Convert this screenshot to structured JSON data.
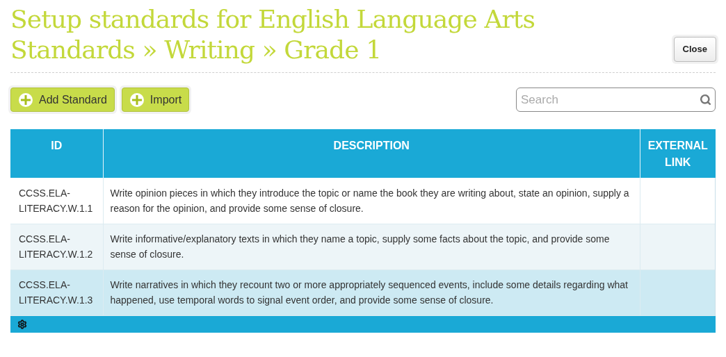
{
  "title_lines": [
    "Setup standards for English Language Arts",
    "Standards » Writing » Grade 1"
  ],
  "close_button": "Close",
  "toolbar_buttons": [
    "Add Standard",
    "Import"
  ],
  "search": {
    "placeholder": "Search"
  },
  "table": {
    "columns": [
      "ID",
      "DESCRIPTION",
      "EXTERNAL LINK"
    ],
    "rows": [
      {
        "id": "CCSS.ELA-LITERACY.W.1.1",
        "description": "Write opinion pieces in which they introduce the topic or name the book they are writing about, state an opinion, supply a reason for the opinion, and provide some sense of closure.",
        "selected": false
      },
      {
        "id": "CCSS.ELA-LITERACY.W.1.2",
        "description": "Write informative/explanatory texts in which they name a topic, supply some facts about the topic, and provide some sense of closure.",
        "selected": false
      },
      {
        "id": "CCSS.ELA-LITERACY.W.1.3",
        "description": "Write narratives in which they recount two or more appropriately sequenced events, include some details regarding what happened, use temporal words to signal event order, and provide some sense of closure.",
        "selected": true
      }
    ]
  }
}
